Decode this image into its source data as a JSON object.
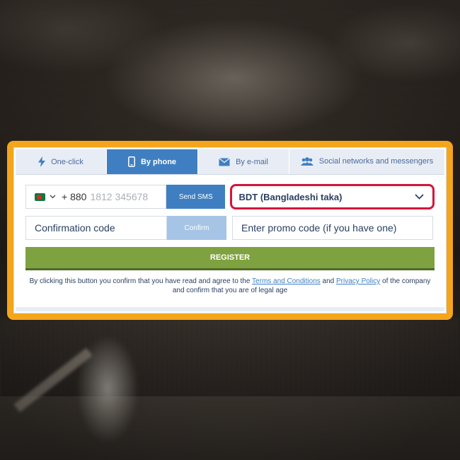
{
  "tabs": [
    {
      "label": "One-click",
      "icon": "lightning-icon",
      "active": false
    },
    {
      "label": "By phone",
      "icon": "phone-icon",
      "active": true
    },
    {
      "label": "By e-mail",
      "icon": "envelope-icon",
      "active": false
    },
    {
      "label": "Social networks and messengers",
      "icon": "users-icon",
      "active": false
    }
  ],
  "phone": {
    "country_flag": "bangladesh-flag-icon",
    "prefix": "+ 880",
    "placeholder": "1812 345678",
    "send_label": "Send SMS"
  },
  "currency": {
    "selected": "BDT (Bangladeshi taka)"
  },
  "confirmation": {
    "placeholder": "Confirmation code",
    "confirm_label": "Confirm"
  },
  "promo": {
    "placeholder": "Enter promo code (if you have one)"
  },
  "register_label": "REGISTER",
  "legal": {
    "text_before": "By clicking this button you confirm that you have read and agree to the",
    "terms_link": "Terms and Conditions",
    "and": "and",
    "privacy_link": "Privacy Policy",
    "text_after": "of the company and confirm that you are of legal age"
  },
  "colors": {
    "frame_orange": "#f4a51c",
    "active_tab_blue": "#3f7fc1",
    "register_green": "#7ea240",
    "highlight_red": "#d5143c"
  }
}
